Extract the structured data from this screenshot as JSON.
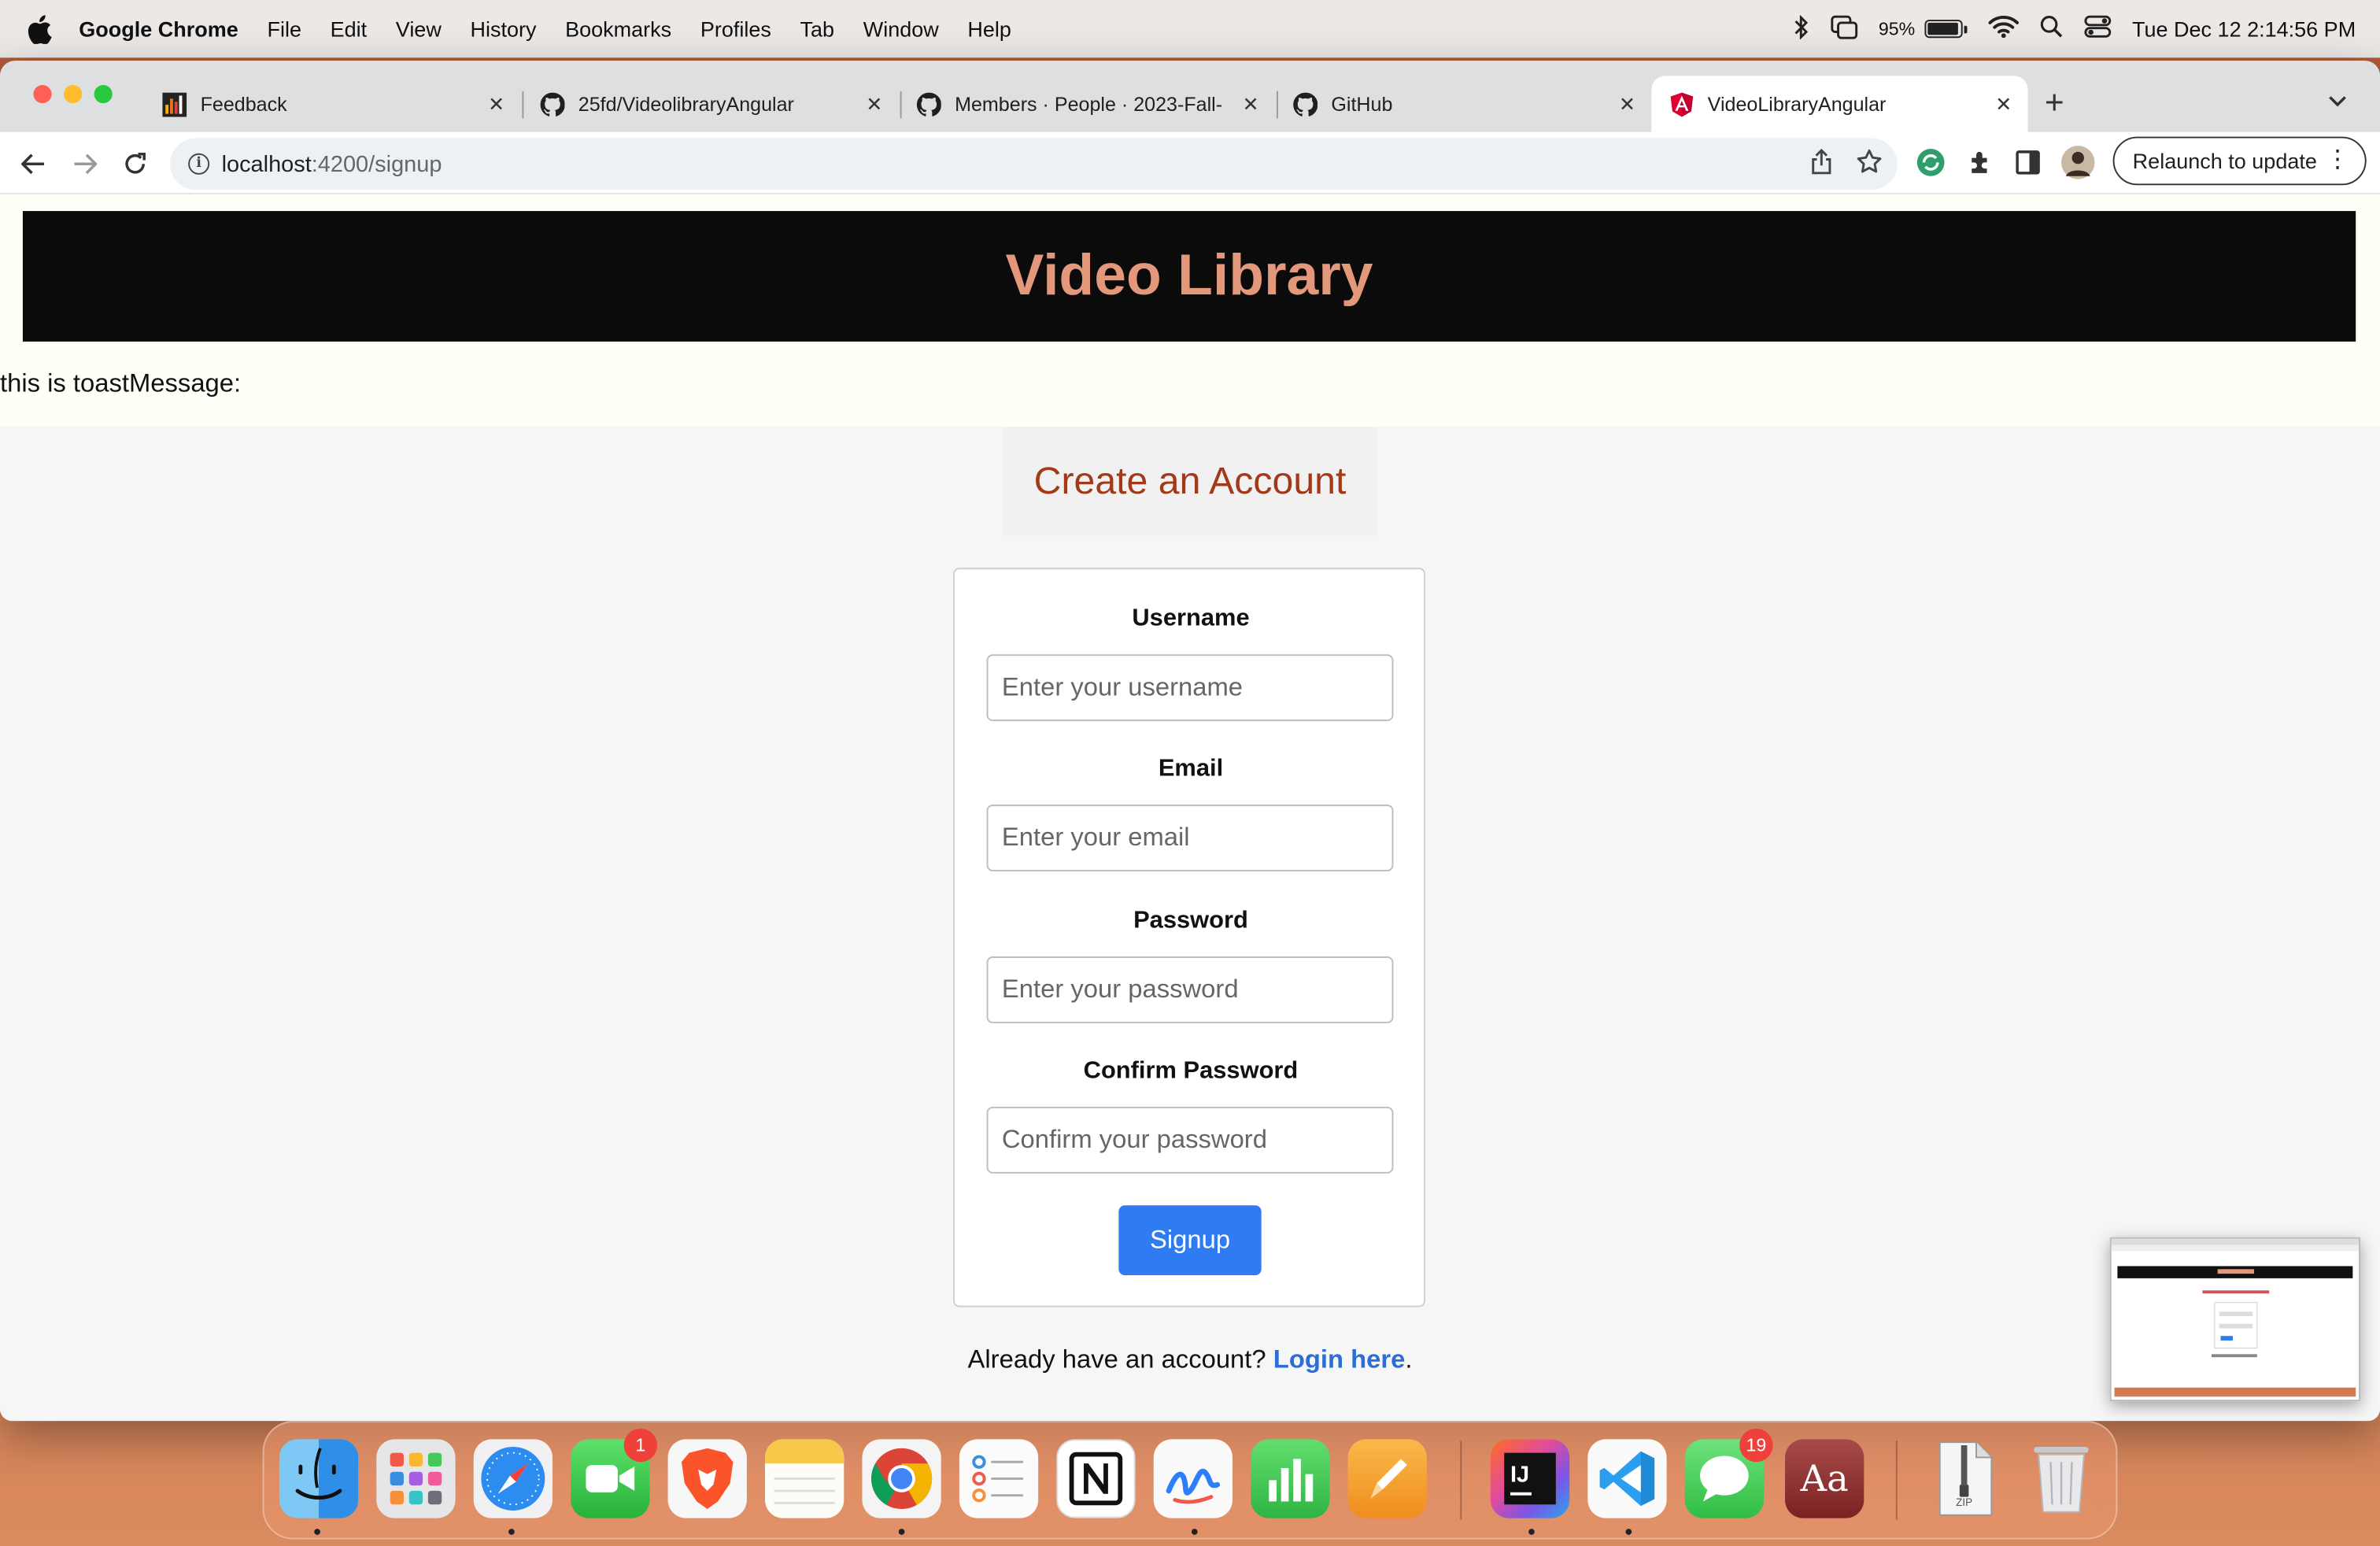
{
  "menubar": {
    "app_name": "Google Chrome",
    "items": [
      "File",
      "Edit",
      "View",
      "History",
      "Bookmarks",
      "Profiles",
      "Tab",
      "Window",
      "Help"
    ],
    "battery_percent": "95%",
    "battery_level": 0.95,
    "clock": "Tue Dec 12  2:14:56 PM"
  },
  "tabs": [
    {
      "title": "Feedback",
      "icon": "bar-chart-favicon-icon"
    },
    {
      "title": "25fd/VideolibraryAngular",
      "icon": "github-icon"
    },
    {
      "title": "Members · People · 2023-Fall-",
      "icon": "github-icon"
    },
    {
      "title": "GitHub",
      "icon": "github-icon"
    },
    {
      "title": "VideoLibraryAngular",
      "icon": "angular-icon",
      "active": true
    }
  ],
  "omnibox": {
    "host": "localhost",
    "path": ":4200/signup"
  },
  "relaunch_label": "Relaunch to update",
  "page": {
    "banner_title": "Video Library",
    "toast_text": "this is toastMessage:",
    "heading": "Create an Account",
    "fields": {
      "username": {
        "label": "Username",
        "placeholder": "Enter your username"
      },
      "email": {
        "label": "Email",
        "placeholder": "Enter your email"
      },
      "password": {
        "label": "Password",
        "placeholder": "Enter your password"
      },
      "confirm": {
        "label": "Confirm Password",
        "placeholder": "Confirm your password"
      }
    },
    "signup_label": "Signup",
    "login_prompt": "Already have an account?",
    "login_link": "Login here",
    "login_period": "."
  },
  "dock": {
    "facetime_badge": "1",
    "messages_badge": "19",
    "intellij_label": "IJ",
    "dictionary_label": "Aa",
    "zip_label": "ZIP"
  },
  "colors": {
    "banner_bg": "#0b0b0b",
    "banner_text": "#e4987b",
    "heading_text": "#a23a1a",
    "signup_button": "#2f7bf1",
    "login_link": "#2b6fd6"
  }
}
